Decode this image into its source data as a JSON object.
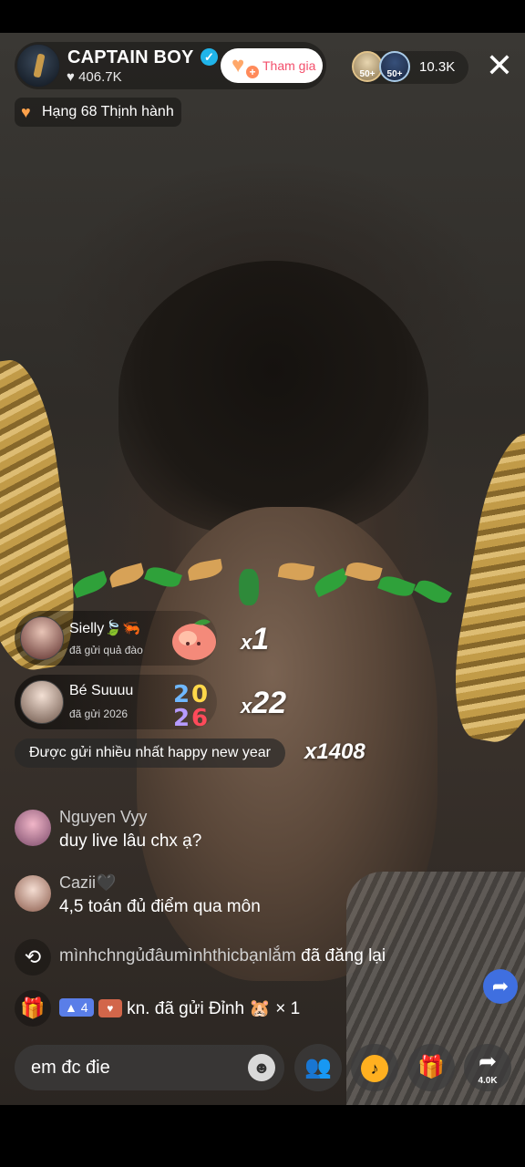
{
  "host": {
    "name": "CAPTAIN BOY",
    "verified_icon": "verified-check-icon",
    "likes": "♥ 406.7K",
    "follow_label": "Tham gia"
  },
  "viewers": {
    "badge_1": "50+",
    "badge_2": "50+",
    "count": "10.3K"
  },
  "rank": {
    "label": "Hạng 68 Thịnh hành"
  },
  "gifts": [
    {
      "user": "Sielly🍃🦐",
      "action": "đã gửi quả đào",
      "count_prefix": "x",
      "count": "1",
      "gift_icon": "peach-gift-icon"
    },
    {
      "user": "Bé Suuuu",
      "action": "đã gửi 2026",
      "count_prefix": "x",
      "count": "22",
      "gift_icon": "2026-gift-icon"
    }
  ],
  "most_sent": {
    "label": "Được gửi nhiều nhất happy new year",
    "count": "x1408"
  },
  "chat": [
    {
      "user": "Nguyen Vyy",
      "message": "duy live lâu chx ạ?"
    },
    {
      "user": "Cazii🖤",
      "message": "4,5 toán đủ điểm qua môn"
    }
  ],
  "repost": {
    "user": "mìnhchngủđâumìnhthicbạnlắm",
    "text": "đã đăng lại"
  },
  "gift_event": {
    "level": "4",
    "user": "kn.",
    "text": "đã gửi Đỉnh",
    "count": "× 1"
  },
  "bottom": {
    "comment_value": "em đc đie",
    "share_count": "4.0K"
  },
  "colors": {
    "follow_text": "#f34f6b",
    "verified": "#20b4ea",
    "share_float": "#3f6fe0"
  }
}
